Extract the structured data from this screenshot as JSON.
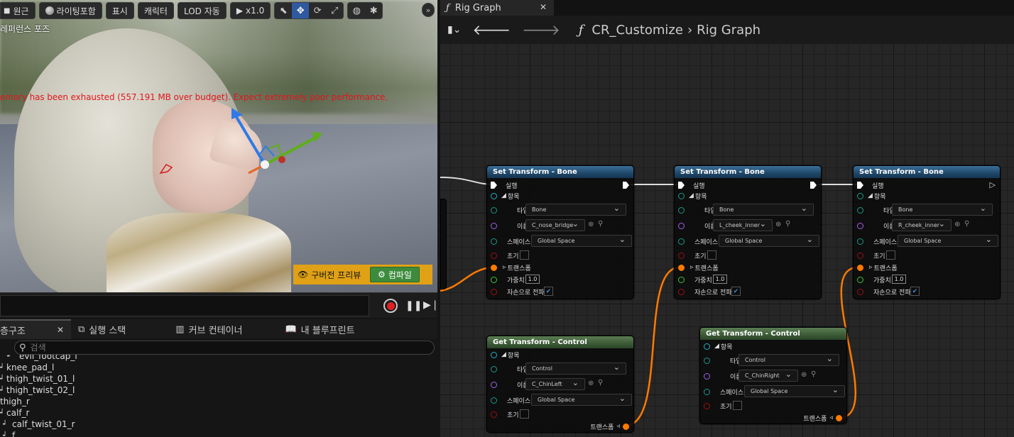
{
  "viewport": {
    "toolbar": {
      "perspective": "원근",
      "lighting": "라이팅포함",
      "show": "표시",
      "character": "캐릭터",
      "lod": "LOD 자동",
      "speed": "x1.0"
    },
    "reference_pose": "레퍼런스 포즈",
    "memory_warning": "emory has been exhausted (557.191 MB over budget). Expect extremely poor performance.",
    "old_preview": "구버전 프리뷰",
    "compile": "컴파일"
  },
  "bottom_tabs": [
    {
      "label": "층구조",
      "active": true
    },
    {
      "label": "실행 스택"
    },
    {
      "label": "커브 컨테이너"
    },
    {
      "label": "내 블루프린트"
    }
  ],
  "search": {
    "placeholder": "검색"
  },
  "tree": [
    {
      "label": "evil_footcap_l",
      "indent": 18
    },
    {
      "label": "knee_pad_l",
      "indent": 0
    },
    {
      "label": "thigh_twist_01_l",
      "indent": 0
    },
    {
      "label": "thigh_twist_02_l",
      "indent": 0
    },
    {
      "label": "thigh_r",
      "indent": 0
    },
    {
      "label": "calf_r",
      "indent": 0
    },
    {
      "label": "calf_twist_01_r",
      "indent": 10
    },
    {
      "label": "f",
      "indent": 10
    }
  ],
  "graph": {
    "tab_label": "Rig Graph",
    "breadcrumb": [
      "CR_Customize",
      "Rig Graph"
    ],
    "set_nodes": [
      {
        "title": "Set Transform - Bone",
        "exec_in": "실행",
        "item": "항목",
        "type_label": "타입",
        "type": "Bone",
        "name_label": "이름",
        "name": "C_nose_bridge",
        "space_label": "스페이스",
        "space": "Global Space",
        "initial": "초기",
        "transform": "트랜스폼",
        "weight_label": "가중치",
        "weight": "1.0",
        "propagate": "자손으로 전파"
      },
      {
        "title": "Set Transform - Bone",
        "exec_in": "실행",
        "item": "항목",
        "type_label": "타입",
        "type": "Bone",
        "name_label": "이름",
        "name": "L_cheek_inner",
        "space_label": "스페이스",
        "space": "Global Space",
        "initial": "초기",
        "transform": "트랜스폼",
        "weight_label": "가중치",
        "weight": "1.0",
        "propagate": "자손으로 전파"
      },
      {
        "title": "Set Transform - Bone",
        "exec_in": "실행",
        "item": "항목",
        "type_label": "타입",
        "type": "Bone",
        "name_label": "이름",
        "name": "R_cheek_inner",
        "space_label": "스페이스",
        "space": "Global Space",
        "initial": "초기",
        "transform": "트랜스폼",
        "weight_label": "가중치",
        "weight": "1.0",
        "propagate": "자손으로 전파"
      }
    ],
    "get_nodes": [
      {
        "title": "Get Transform - Control",
        "item": "항목",
        "type_label": "타입",
        "type": "Control",
        "name_label": "이름",
        "name": "C_ChinLeft",
        "space_label": "스페이스",
        "space": "Global Space",
        "initial": "초기",
        "transform": "트랜스폼"
      },
      {
        "title": "Get Transform - Control",
        "item": "항목",
        "type_label": "타입",
        "type": "Control",
        "name_label": "이름",
        "name": "C_ChinRight",
        "space_label": "스페이스",
        "space": "Global Space",
        "initial": "초기",
        "transform": "트랜스폼"
      }
    ]
  },
  "colors": {
    "warning_red": "#e2161b",
    "compile_bar": "#e0a116",
    "compile_button": "#3d8b3d",
    "set_node_header": "#1f4768",
    "get_node_header": "#3c5a37",
    "transform_wire": "#ff7a00"
  }
}
